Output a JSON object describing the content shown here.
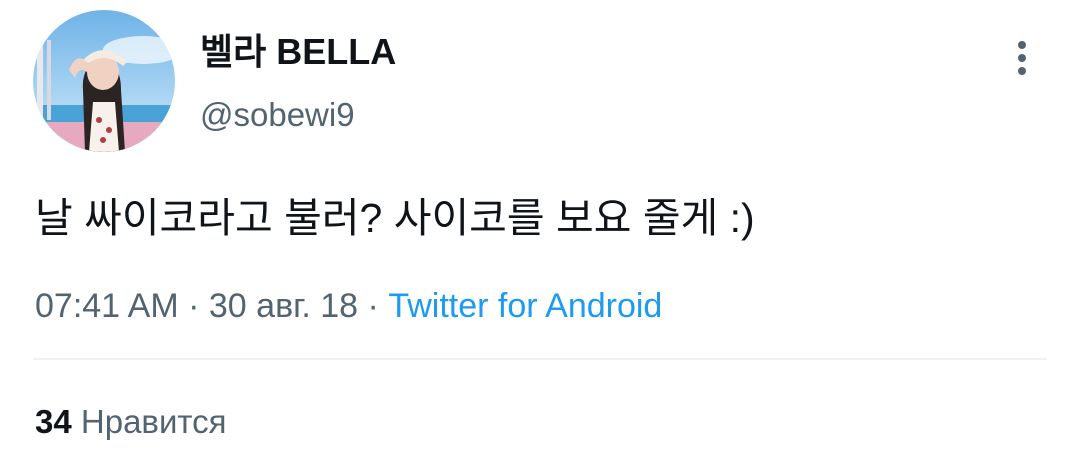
{
  "tweet": {
    "author": {
      "display_name": "벨라 BELLA",
      "handle": "@sobewi9"
    },
    "text": "날 싸이코라고 불러? 사이코를 보요 줄게 :)",
    "time": "07:41 AM",
    "date": "30 авг. 18",
    "separator": "·",
    "source": "Twitter for Android",
    "likes_count": "34",
    "likes_label": "Нравится"
  },
  "icons": {
    "menu": "more-vertical-icon"
  },
  "colors": {
    "text_primary": "#0f1419",
    "text_secondary": "#536471",
    "link": "#1d9bf0",
    "divider": "#eff3f4"
  }
}
